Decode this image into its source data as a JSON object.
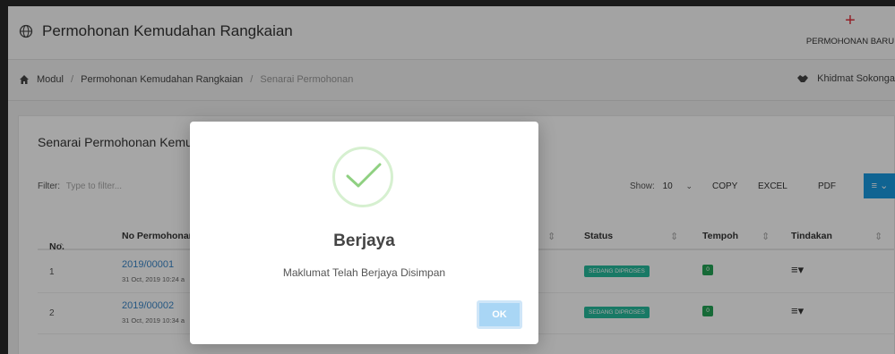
{
  "header": {
    "title": "Permohonan Kemudahan Rangkaian",
    "new_button_icon": "plus-icon",
    "new_button_label": "PERMOHONAN BARU"
  },
  "breadcrumb": {
    "home_icon": "home-icon",
    "items": [
      "Modul",
      "Permohonan Kemudahan Rangkaian",
      "Senarai Permohonan"
    ],
    "service_label": "Khidmat Sokonga"
  },
  "panel": {
    "title": "Senarai Permohonan Kemud",
    "filter_label": "Filter:",
    "filter_placeholder": "Type to filter...",
    "show_label": "Show:",
    "show_value": "10",
    "buttons": [
      "COPY",
      "EXCEL",
      "PDF"
    ],
    "menu_button_icon": "list-menu-icon"
  },
  "table": {
    "headers": [
      "No.",
      "No Permohonan",
      "Status",
      "Tempoh",
      "Tindakan"
    ],
    "rows": [
      {
        "no": "1",
        "id": "2019/00001",
        "date": "31 Oct, 2019 10:24 a",
        "status": "SEDANG DIPROSES",
        "tempoh": "0"
      },
      {
        "no": "2",
        "id": "2019/00002",
        "date": "31 Oct, 2019 10:34 a",
        "status": "SEDANG DIPROSES",
        "tempoh": "0"
      }
    ]
  },
  "modal": {
    "icon": "check-icon",
    "title": "Berjaya",
    "message": "Maklumat Telah Berjaya Disimpan",
    "ok_label": "OK"
  },
  "colors": {
    "accent_red": "#e0323c",
    "link_blue": "#3a86c8",
    "status_teal": "#25bb9b",
    "tempoh_green": "#23a455",
    "button_blue": "#1a9ae0",
    "ok_blue": "#a9d6f5"
  }
}
